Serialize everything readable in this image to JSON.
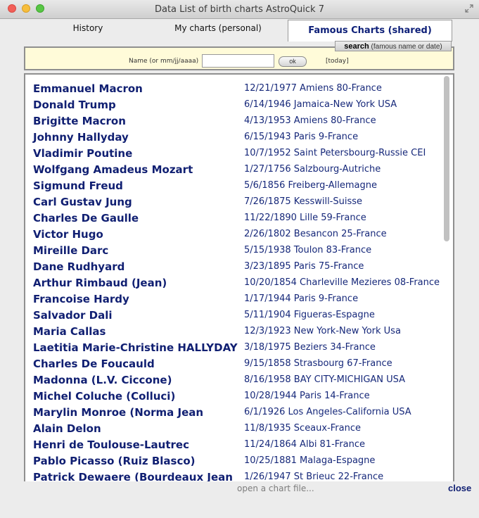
{
  "window": {
    "title": "Data List of birth charts AstroQuick 7"
  },
  "tabs": [
    {
      "label": "History"
    },
    {
      "label": "My charts (personal)"
    },
    {
      "label": "Famous Charts (shared)"
    }
  ],
  "search": {
    "button_label": "search",
    "button_hint": "(famous name or date)",
    "name_label": "Name (or mm/jj/aaaa)",
    "name_value": "",
    "ok_label": "ok",
    "today_label": "[today]"
  },
  "charts": [
    {
      "name": "Emmanuel Macron",
      "birth": "12/21/1977 Amiens 80-France"
    },
    {
      "name": "Donald Trump",
      "birth": "6/14/1946 Jamaica-New York USA"
    },
    {
      "name": "Brigitte Macron",
      "birth": "4/13/1953 Amiens 80-France"
    },
    {
      "name": "Johnny Hallyday",
      "birth": "6/15/1943 Paris 9-France"
    },
    {
      "name": "Vladimir Poutine",
      "birth": "10/7/1952 Saint Petersbourg-Russie CEI"
    },
    {
      "name": "Wolfgang Amadeus Mozart",
      "birth": "1/27/1756 Salzbourg-Autriche"
    },
    {
      "name": "Sigmund Freud",
      "birth": "5/6/1856 Freiberg-Allemagne"
    },
    {
      "name": "Carl Gustav Jung",
      "birth": "7/26/1875 Kesswill-Suisse"
    },
    {
      "name": "Charles De Gaulle",
      "birth": "11/22/1890 Lille 59-France"
    },
    {
      "name": "Victor Hugo",
      "birth": "2/26/1802 Besancon 25-France"
    },
    {
      "name": "Mireille Darc",
      "birth": "5/15/1938 Toulon 83-France"
    },
    {
      "name": "Dane Rudhyard",
      "birth": "3/23/1895 Paris 75-France"
    },
    {
      "name": "Arthur Rimbaud (Jean)",
      "birth": "10/20/1854 Charleville Mezieres 08-France"
    },
    {
      "name": "Francoise Hardy",
      "birth": "1/17/1944 Paris 9-France"
    },
    {
      "name": "Salvador Dali",
      "birth": "5/11/1904 Figueras-Espagne"
    },
    {
      "name": "Maria Callas",
      "birth": "12/3/1923 New York-New York Usa"
    },
    {
      "name": "Laetitia Marie-Christine HALLYDAY",
      "birth": "3/18/1975 Beziers 34-France"
    },
    {
      "name": "Charles De Foucauld",
      "birth": "9/15/1858 Strasbourg 67-France"
    },
    {
      "name": "Madonna (L.V. Ciccone)",
      "birth": "8/16/1958 BAY CITY-MICHIGAN USA"
    },
    {
      "name": "Michel Coluche (Colluci)",
      "birth": "10/28/1944 Paris 14-France"
    },
    {
      "name": "Marylin Monroe (Norma Jean",
      "birth": "6/1/1926 Los Angeles-California USA"
    },
    {
      "name": "Alain Delon",
      "birth": "11/8/1935 Sceaux-France"
    },
    {
      "name": "Henri de Toulouse-Lautrec",
      "birth": "11/24/1864 Albi 81-France"
    },
    {
      "name": "Pablo Picasso (Ruiz Blasco)",
      "birth": "10/25/1881 Malaga-Espagne"
    },
    {
      "name": "Patrick Dewaere (Bourdeaux Jean",
      "birth": "1/26/1947 St Brieuc 22-France"
    }
  ],
  "footer": {
    "open_file_label": "open a chart file...",
    "close_label": "close"
  }
}
